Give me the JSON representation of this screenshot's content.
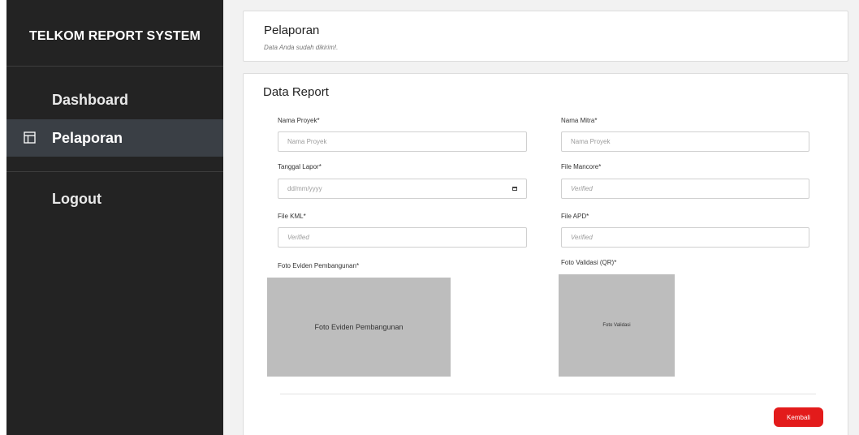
{
  "sidebar": {
    "brand": "TELKOM REPORT SYSTEM",
    "items": [
      {
        "label": "Dashboard",
        "active": false
      },
      {
        "label": "Pelaporan",
        "active": true,
        "icon": "table-layout-icon"
      },
      {
        "label": "Logout",
        "active": false
      }
    ]
  },
  "notice": {
    "title": "Pelaporan",
    "message": "Data Anda sudah dikirim!."
  },
  "form": {
    "title": "Data Report",
    "fields": {
      "nama_proyek": {
        "label": "Nama Proyek*",
        "placeholder": "Nama Proyek"
      },
      "nama_mitra": {
        "label": "Nama Mitra*",
        "placeholder": "Nama Proyek"
      },
      "tanggal_lapor": {
        "label": "Tanggal Lapor*",
        "placeholder": "dd/mm/yyyy"
      },
      "file_mancore": {
        "label": "File Mancore*",
        "value": "Verified"
      },
      "file_kml": {
        "label": "File KML*",
        "value": "Verified"
      },
      "file_apd": {
        "label": "File APD*",
        "value": "Verified"
      },
      "foto_eviden": {
        "label": "Foto Eviden Pembangunan*",
        "image_text": "Foto Eviden Pembangunan"
      },
      "foto_validasi": {
        "label": "Foto Validasi (QR)*",
        "image_text": "Foto Validasi"
      }
    },
    "back_button": "Kembali"
  },
  "colors": {
    "sidebar_bg": "#232323",
    "sidebar_active": "#3a3f45",
    "accent_button": "#e31b1b",
    "page_bg": "#f2f2f2"
  }
}
